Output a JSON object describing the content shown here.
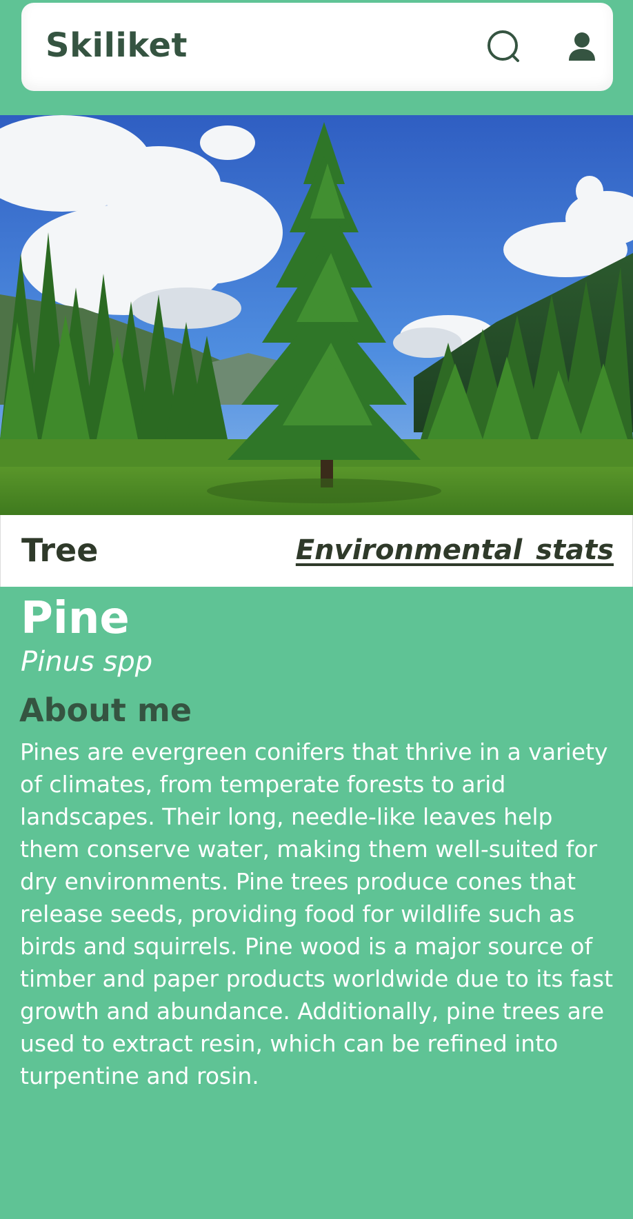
{
  "app": {
    "brand": "Skiliket"
  },
  "header": {
    "search_icon": "search-icon",
    "user_icon": "user-icon"
  },
  "hero": {
    "image": "pine-tree-photo"
  },
  "info_bar": {
    "category": "Tree",
    "stats_link": "Environmental  stats"
  },
  "species": {
    "name": "Pine",
    "scientific_name": "Pinus spp"
  },
  "about": {
    "title": "About me",
    "text": "Pines are evergreen conifers that thrive in a variety of climates, from temperate forests to arid landscapes. Their long, needle-like leaves help them conserve water, making them well-suited for dry environments. Pine trees produce cones that release seeds, providing food for wildlife such as birds and squirrels. Pine wood is a major source of timber and paper products worldwide due to its fast growth and abundance. Additionally, pine trees are used to extract resin, which can be refined into turpentine and rosin."
  },
  "colors": {
    "background": "#5fc395",
    "brand_text": "#355441",
    "card": "#ffffff"
  }
}
